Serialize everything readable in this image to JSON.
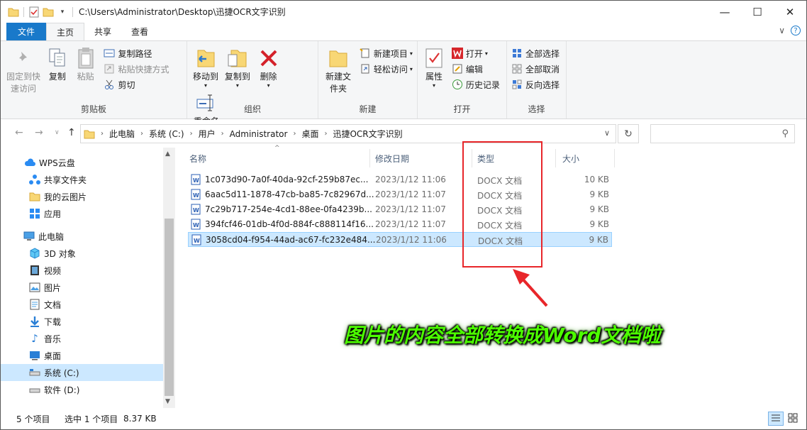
{
  "window": {
    "title_path": "C:\\Users\\Administrator\\Desktop\\迅捷OCR文字识别",
    "minimize": "—",
    "maximize": "☐",
    "close": "✕"
  },
  "tabs": {
    "file": "文件",
    "home": "主页",
    "share": "共享",
    "view": "查看",
    "expand": "∨",
    "help": "?"
  },
  "ribbon": {
    "clipboard": {
      "label": "剪贴板",
      "pin": "固定到快速访问",
      "copy": "复制",
      "paste": "粘贴",
      "copy_path": "复制路径",
      "paste_shortcut": "粘贴快捷方式",
      "cut": "剪切"
    },
    "organize": {
      "label": "组织",
      "move_to": "移动到",
      "copy_to": "复制到",
      "delete": "删除",
      "rename": "重命名"
    },
    "new": {
      "label": "新建",
      "new_folder": "新建文件夹",
      "new_item": "新建项目",
      "easy_access": "轻松访问"
    },
    "open": {
      "label": "打开",
      "properties": "属性",
      "open": "打开",
      "edit": "编辑",
      "history": "历史记录"
    },
    "select": {
      "label": "选择",
      "select_all": "全部选择",
      "select_none": "全部取消",
      "invert": "反向选择"
    }
  },
  "address": {
    "crumbs": [
      "此电脑",
      "系统 (C:)",
      "用户",
      "Administrator",
      "桌面",
      "迅捷OCR文字识别"
    ],
    "search_placeholder": ""
  },
  "nav": {
    "items": [
      {
        "label": "WPS云盘",
        "icon": "cloud-icon"
      },
      {
        "label": "共享文件夹",
        "icon": "share-folder-icon"
      },
      {
        "label": "我的云图片",
        "icon": "folder-icon"
      },
      {
        "label": "应用",
        "icon": "apps-icon"
      },
      {
        "label": "此电脑",
        "icon": "computer-icon"
      },
      {
        "label": "3D 对象",
        "icon": "cube-icon"
      },
      {
        "label": "视频",
        "icon": "video-icon"
      },
      {
        "label": "图片",
        "icon": "picture-icon"
      },
      {
        "label": "文档",
        "icon": "document-icon"
      },
      {
        "label": "下载",
        "icon": "download-icon"
      },
      {
        "label": "音乐",
        "icon": "music-icon"
      },
      {
        "label": "桌面",
        "icon": "desktop-icon"
      },
      {
        "label": "系统 (C:)",
        "icon": "drive-icon"
      },
      {
        "label": "软件 (D:)",
        "icon": "drive-icon"
      }
    ]
  },
  "columns": {
    "name": "名称",
    "date": "修改日期",
    "type": "类型",
    "size": "大小"
  },
  "files": [
    {
      "name": "1c073d90-7a0f-40da-92cf-259b87ec...",
      "date": "2023/1/12 11:06",
      "type": "DOCX 文档",
      "size": "10 KB"
    },
    {
      "name": "6aac5d11-1878-47cb-ba85-7c82967d...",
      "date": "2023/1/12 11:07",
      "type": "DOCX 文档",
      "size": "9 KB"
    },
    {
      "name": "7c29b717-254e-4cd1-88ee-0fa4239b...",
      "date": "2023/1/12 11:07",
      "type": "DOCX 文档",
      "size": "9 KB"
    },
    {
      "name": "394fcf46-01db-4f0d-884f-c888114f16...",
      "date": "2023/1/12 11:07",
      "type": "DOCX 文档",
      "size": "9 KB"
    },
    {
      "name": "3058cd04-f954-44ad-ac67-fc232e484...",
      "date": "2023/1/12 11:06",
      "type": "DOCX 文档",
      "size": "9 KB"
    }
  ],
  "annotation": {
    "caption": "图片的内容全部转换成Word文档啦",
    "caption_color": "#4cff00",
    "box_color": "#e8262a"
  },
  "status": {
    "count": "5 个项目",
    "selected": "选中 1 个项目",
    "size": "8.37 KB"
  }
}
